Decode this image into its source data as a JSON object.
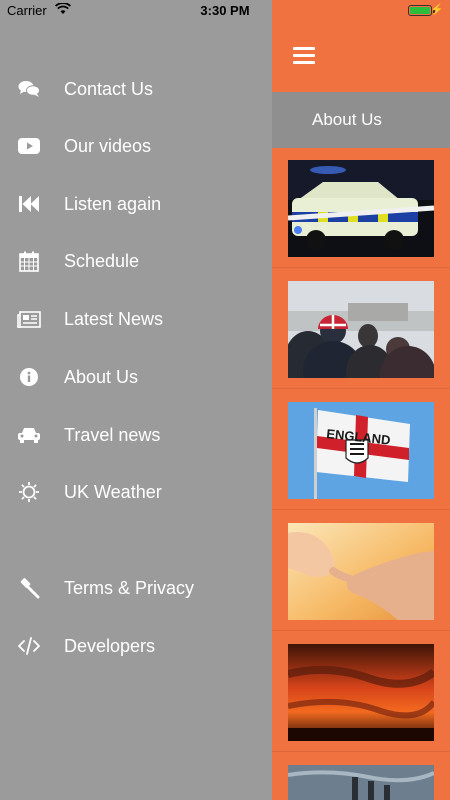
{
  "status_bar": {
    "carrier": "Carrier",
    "time": "3:30 PM"
  },
  "menu": {
    "items": [
      {
        "label": "Contact Us",
        "icon": "chat-icon"
      },
      {
        "label": "Our videos",
        "icon": "youtube-icon"
      },
      {
        "label": "Listen again",
        "icon": "rewind-icon"
      },
      {
        "label": "Schedule",
        "icon": "calendar-icon"
      },
      {
        "label": "Latest News",
        "icon": "newspaper-icon"
      },
      {
        "label": "About Us",
        "icon": "info-icon"
      },
      {
        "label": "Travel news",
        "icon": "car-icon"
      },
      {
        "label": "UK Weather",
        "icon": "sun-icon"
      },
      {
        "label": "Terms & Privacy",
        "icon": "gavel-icon"
      },
      {
        "label": "Developers",
        "icon": "code-icon"
      }
    ]
  },
  "panel": {
    "section_title": "About Us",
    "thumbnails": [
      {
        "subject": "police-car"
      },
      {
        "subject": "crowd"
      },
      {
        "subject": "england-flag",
        "flag_text": "ENGLAND"
      },
      {
        "subject": "hands"
      },
      {
        "subject": "sunset-sky"
      },
      {
        "subject": "sea-groyne"
      }
    ]
  },
  "colors": {
    "accent": "#f07240",
    "menu_bg": "#9b9b9b",
    "header_bar": "#8f8f8f"
  }
}
